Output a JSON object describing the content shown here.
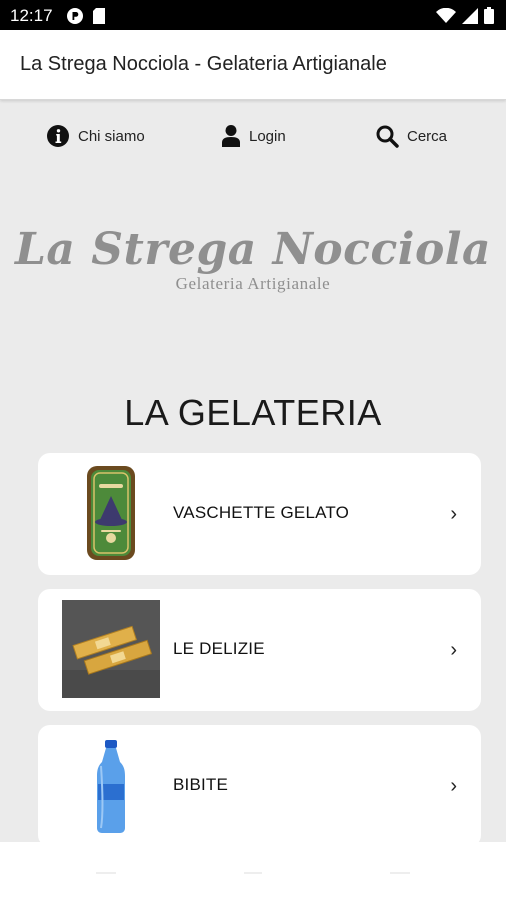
{
  "status_bar": {
    "time": "12:17"
  },
  "app_bar": {
    "title": "La Strega Nocciola - Gelateria Artigianale"
  },
  "quick_nav": {
    "items": [
      {
        "label": "Chi siamo",
        "icon": "info-icon"
      },
      {
        "label": "Login",
        "icon": "user-icon"
      },
      {
        "label": "Cerca",
        "icon": "search-icon"
      }
    ]
  },
  "logo": {
    "name": "La Strega Nocciola",
    "tagline": "Gelateria Artigianale"
  },
  "section": {
    "title": "LA GELATERIA"
  },
  "categories": [
    {
      "label": "VASCHETTE GELATO",
      "image": "green-sign-image",
      "chevron": "›"
    },
    {
      "label": "LE DELIZIE",
      "image": "wrapped-bars-image",
      "chevron": "›"
    },
    {
      "label": "BIBITE",
      "image": "water-bottle-image",
      "chevron": "›"
    }
  ],
  "colors": {
    "background": "#ebebeb",
    "card": "#ffffff",
    "logo_text": "#8f8f8f"
  }
}
